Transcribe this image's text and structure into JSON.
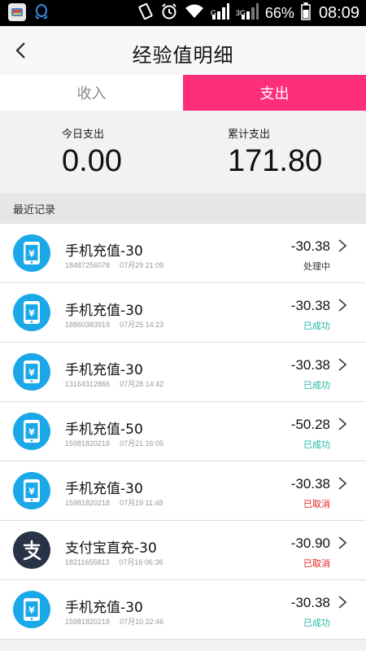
{
  "status_bar": {
    "network_small": "G",
    "network_3g": "3G",
    "battery": "66%",
    "time": "08:09"
  },
  "header": {
    "title": "经验值明细"
  },
  "tabs": {
    "income": "收入",
    "expense": "支出",
    "active": "expense",
    "active_color": "#ff2e7a"
  },
  "summary": {
    "today_label": "今日支出",
    "today_value": "0.00",
    "total_label": "累计支出",
    "total_value": "171.80"
  },
  "section": {
    "title": "最近记录"
  },
  "colors": {
    "processing": "#333333",
    "success": "#1fb8a4",
    "cancelled": "#e02020",
    "phone_icon_bg": "#1aa8e8",
    "alipay_icon_bg": "#283347"
  },
  "records": [
    {
      "icon": "phone-recharge-icon",
      "title": "手机充值-30",
      "phone": "18487256078",
      "time": "07月29 21:09",
      "amount": "-30.38",
      "status": "处理中",
      "status_type": "processing"
    },
    {
      "icon": "phone-recharge-icon",
      "title": "手机充值-30",
      "phone": "18860383919",
      "time": "07月25 14:23",
      "amount": "-30.38",
      "status": "已成功",
      "status_type": "success"
    },
    {
      "icon": "phone-recharge-icon",
      "title": "手机充值-30",
      "phone": "13164312866",
      "time": "07月28 14:42",
      "amount": "-30.38",
      "status": "已成功",
      "status_type": "success"
    },
    {
      "icon": "phone-recharge-icon",
      "title": "手机充值-50",
      "phone": "15981820218",
      "time": "07月21 16:05",
      "amount": "-50.28",
      "status": "已成功",
      "status_type": "success"
    },
    {
      "icon": "phone-recharge-icon",
      "title": "手机充值-30",
      "phone": "15981820218",
      "time": "07月19 11:48",
      "amount": "-30.38",
      "status": "已取消",
      "status_type": "cancelled"
    },
    {
      "icon": "alipay-icon",
      "title": "支付宝直充-30",
      "phone": "18211655813",
      "time": "07月16 06:36",
      "amount": "-30.90",
      "status": "已取消",
      "status_type": "cancelled"
    },
    {
      "icon": "phone-recharge-icon",
      "title": "手机充值-30",
      "phone": "15981820218",
      "time": "07月10 22:46",
      "amount": "-30.38",
      "status": "已成功",
      "status_type": "success"
    }
  ]
}
